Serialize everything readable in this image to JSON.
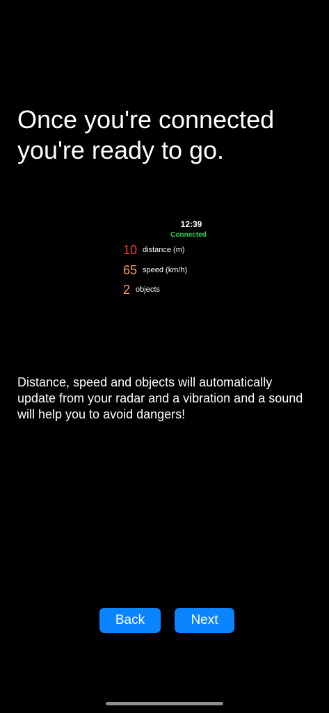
{
  "headline": "Once you're connected you're ready to go.",
  "preview": {
    "time": "12:39",
    "status": "Connected",
    "metrics": [
      {
        "value": "10",
        "label": "distance (m)"
      },
      {
        "value": "65",
        "label": "speed (km/h)"
      },
      {
        "value": "2",
        "label": "objects"
      }
    ]
  },
  "description": "Distance, speed and objects will automatically update from your radar and a vibration and a sound will help you to avoid dangers!",
  "buttons": {
    "back_label": "Back",
    "next_label": "Next"
  },
  "colors": {
    "background": "#000000",
    "status_connected": "#30d158",
    "distance_value": "#ff3b30",
    "speed_value": "#ff9f5a",
    "objects_value": "#ff9f5a",
    "button_fill": "#0a84ff"
  }
}
